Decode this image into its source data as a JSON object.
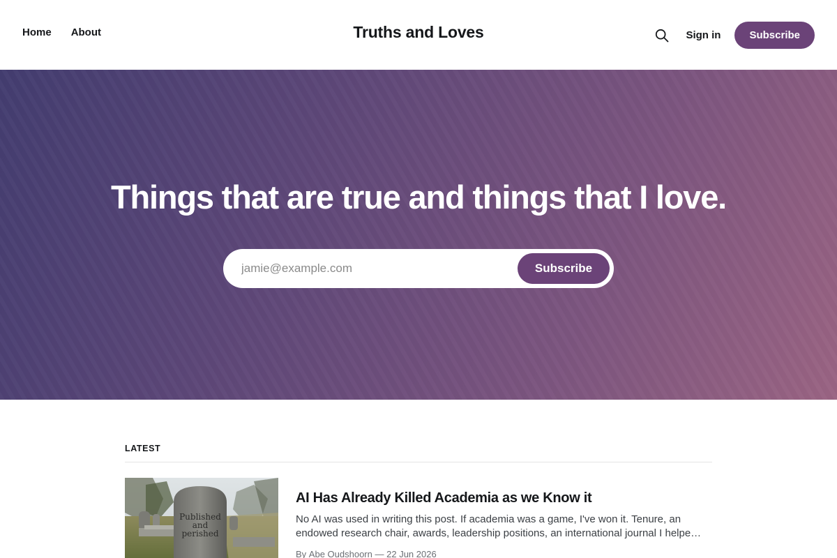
{
  "header": {
    "nav": [
      {
        "label": "Home"
      },
      {
        "label": "About"
      }
    ],
    "site_title": "Truths and Loves",
    "search_icon": "search-icon",
    "signin_label": "Sign in",
    "subscribe_label": "Subscribe"
  },
  "hero": {
    "headline": "Things that are true and things that I love.",
    "email_placeholder": "jamie@example.com",
    "subscribe_label": "Subscribe"
  },
  "latest": {
    "label": "LATEST",
    "posts": [
      {
        "title": "AI Has Already Killed Academia as we Know it",
        "excerpt": "No AI was used in writing this post. If academia was a game, I've won it. Tenure, an endowed research chair, awards, leadership positions, an international journal I helpe…",
        "author_prefix": "By",
        "author": "Abe Oudshoorn",
        "separator": "—",
        "date": "22 Jun 2026",
        "image_caption": "Published and perished"
      }
    ]
  },
  "colors": {
    "accent": "#6b4378",
    "hero_gradient_start": "#433d70",
    "hero_gradient_end": "#9a6483",
    "text": "#15171a"
  }
}
